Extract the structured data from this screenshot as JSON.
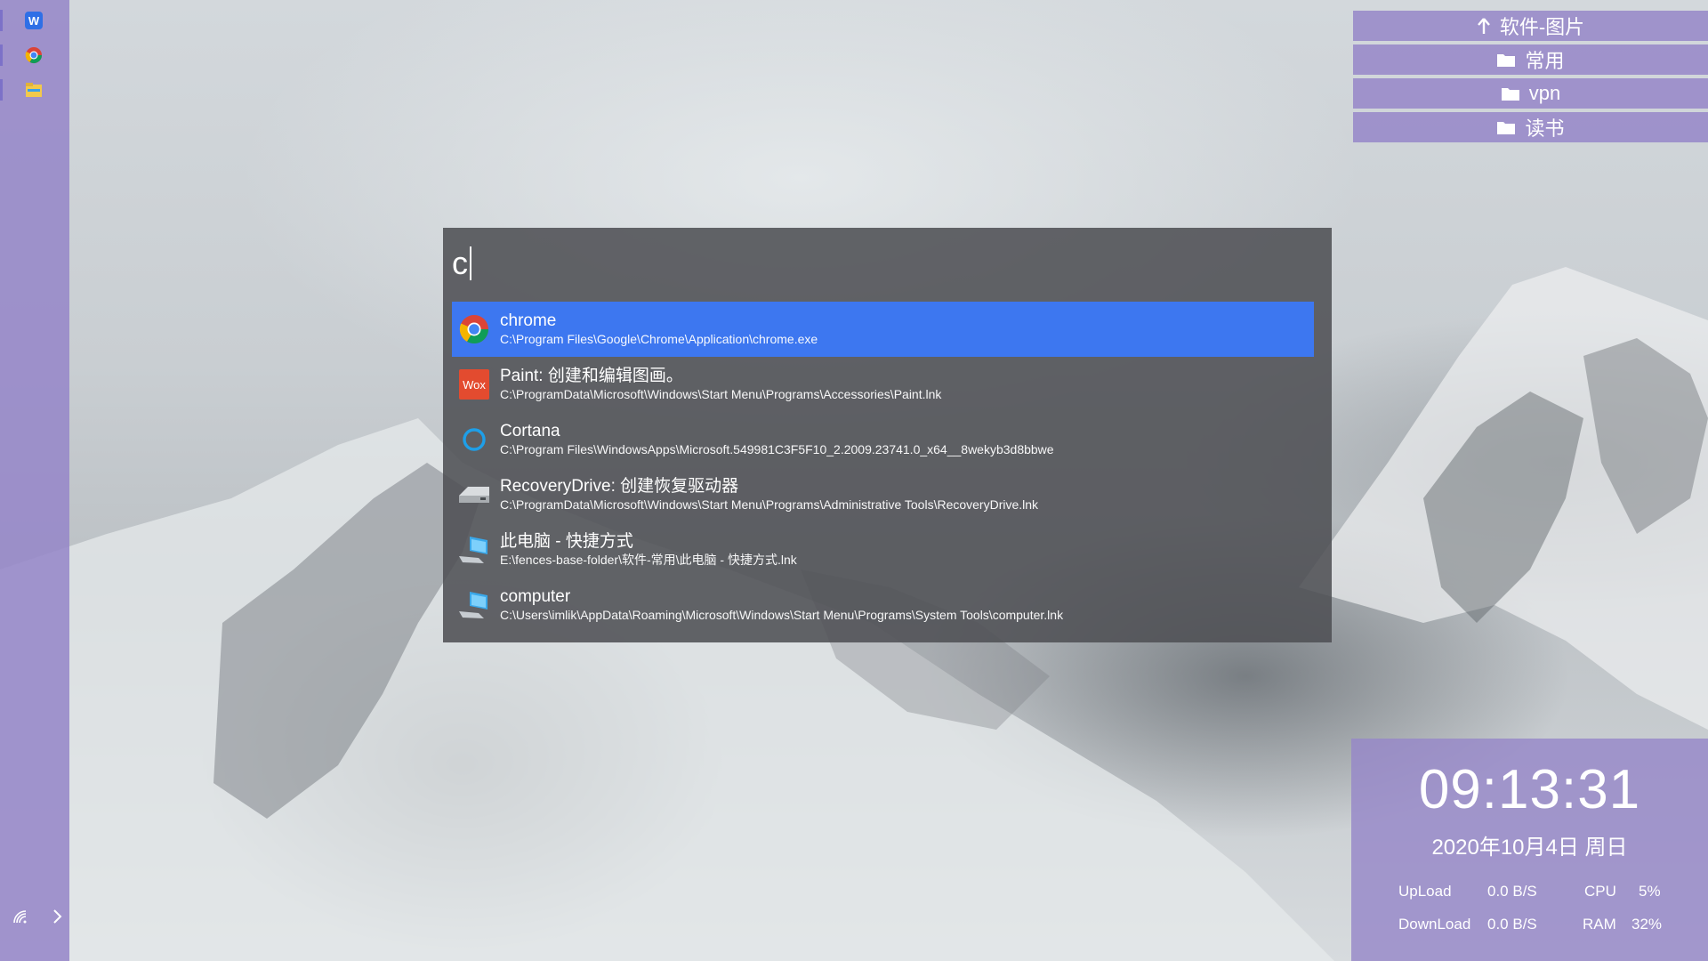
{
  "launcher": {
    "query": "c",
    "results": [
      {
        "title": "chrome",
        "subtitle": "C:\\Program Files\\Google\\Chrome\\Application\\chrome.exe",
        "icon": "chrome-icon"
      },
      {
        "title": "Paint: 创建和编辑图画。",
        "subtitle": "C:\\ProgramData\\Microsoft\\Windows\\Start Menu\\Programs\\Accessories\\Paint.lnk",
        "icon": "wox-icon",
        "icon_text": "Wox"
      },
      {
        "title": "Cortana",
        "subtitle": "C:\\Program Files\\WindowsApps\\Microsoft.549981C3F5F10_2.2009.23741.0_x64__8wekyb3d8bbwe",
        "icon": "cortana-icon"
      },
      {
        "title": "RecoveryDrive: 创建恢复驱动器",
        "subtitle": "C:\\ProgramData\\Microsoft\\Windows\\Start Menu\\Programs\\Administrative Tools\\RecoveryDrive.lnk",
        "icon": "drive-icon"
      },
      {
        "title": "此电脑 - 快捷方式",
        "subtitle": "E:\\fences-base-folder\\软件-常用\\此电脑 - 快捷方式.lnk",
        "icon": "computer-icon"
      },
      {
        "title": "computer",
        "subtitle": "C:\\Users\\imlik\\AppData\\Roaming\\Microsoft\\Windows\\Start Menu\\Programs\\System Tools\\computer.lnk",
        "icon": "computer-icon"
      }
    ],
    "selected_index": 0,
    "selected_color": "#3d77f0"
  },
  "folders": [
    {
      "label": "软件-图片",
      "icon": "up-arrow-icon"
    },
    {
      "label": "常用",
      "icon": "folder-icon"
    },
    {
      "label": "vpn",
      "icon": "folder-icon"
    },
    {
      "label": "读书",
      "icon": "folder-icon"
    }
  ],
  "left_bar": {
    "apps": [
      "wps-writer-icon",
      "chrome-icon",
      "file-explorer-icon"
    ]
  },
  "clock": {
    "time": "09:13:31",
    "date": "2020年10月4日 周日",
    "upload_label": "UpLoad",
    "upload_value": "0.0 B/S",
    "download_label": "DownLoad",
    "download_value": "0.0 B/S",
    "cpu_label": "CPU",
    "cpu_value": "5%",
    "ram_label": "RAM",
    "ram_value": "32%"
  },
  "colors": {
    "widget_purple": "#9687c8",
    "launcher_bg": "#4e5054"
  }
}
